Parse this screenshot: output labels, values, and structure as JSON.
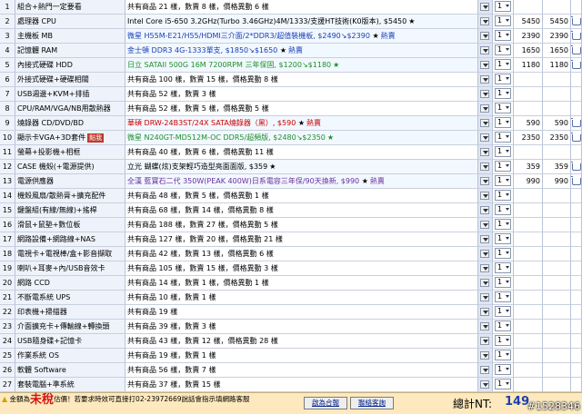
{
  "rows": [
    {
      "num": "1",
      "cat": "組合+熱門一定要看",
      "item": "共有商品 21 樣，數賣 8 樣，價格異動 6 樣",
      "type": "summary",
      "qty": "1"
    },
    {
      "num": "2",
      "cat": "處理器 CPU",
      "item": "Intel Core i5-650 3.2GHz(Turbo 3.46GHz)4M/1333/支援HT技術(K0版本), $5450",
      "type": "selected",
      "color": "black",
      "star": "★",
      "qty": "1",
      "price": "5450",
      "sub": "5450"
    },
    {
      "num": "3",
      "cat": "主機板 MB",
      "item": "微星 H55M-E21/H55/HDMI三介面/2*DDR3/超值裝機板, $2490↘$2390",
      "badge": "熱賣",
      "type": "selected",
      "color": "blue",
      "star": "★",
      "qty": "1",
      "price": "2390",
      "sub": "2390"
    },
    {
      "num": "4",
      "cat": "記憶體 RAM",
      "item": "金士頓 DDR3 4G-1333單支, $1850↘$1650",
      "badge": "熱賣",
      "type": "selected",
      "color": "blue",
      "star": "★",
      "qty": "1",
      "price": "1650",
      "sub": "1650"
    },
    {
      "num": "5",
      "cat": "內接式硬碟 HDD",
      "item": "日立 SATAII 500G 16M 7200RPM 三年保固, $1200↘$1180",
      "type": "selected",
      "color": "green",
      "star": "★",
      "starColor": "g",
      "qty": "1",
      "price": "1180",
      "sub": "1180"
    },
    {
      "num": "6",
      "cat": "外接式硬碟+硬碟相關",
      "item": "共有商品 100 樣，數賣 15 樣，價格異動 8 樣",
      "type": "summary",
      "qty": "1"
    },
    {
      "num": "7",
      "cat": "USB週邊+KVM+排插",
      "item": "共有商品 52 樣，數賣 3 樣",
      "type": "summary",
      "qty": "1"
    },
    {
      "num": "8",
      "cat": "CPU/RAM/VGA/NB用散熱器",
      "item": "共有商品 52 樣，數賣 5 樣，價格異動 5 樣",
      "type": "summary",
      "qty": "1"
    },
    {
      "num": "9",
      "cat": "燒錄器 CD/DVD/BD",
      "item": "華碩 DRW-24B3ST/24X SATA燒錄器（黑）, $590",
      "badge": "熱賣",
      "type": "selected",
      "color": "red",
      "star": "★",
      "qty": "1",
      "price": "590",
      "sub": "590"
    },
    {
      "num": "10",
      "cat": "顯示卡VGA+3D套件",
      "tag": "點我",
      "item": "微星 N240GT-MD512M-OC DDR5/超頻版, $2480↘$2350",
      "type": "selected",
      "color": "green",
      "star": "★",
      "starColor": "g",
      "qty": "1",
      "price": "2350",
      "sub": "2350"
    },
    {
      "num": "11",
      "cat": "螢幕+投影機+相框",
      "item": "共有商品 40 樣，數賣 6 樣，價格異動 11 樣",
      "type": "summary",
      "qty": "1"
    },
    {
      "num": "12",
      "cat": "CASE 機殼(+電源提供)",
      "item": "立光 蝴蝶(炫)支架輕巧造型亮面面版, $359",
      "type": "selected",
      "color": "black",
      "star": "★",
      "qty": "1",
      "price": "359",
      "sub": "359"
    },
    {
      "num": "13",
      "cat": "電源供應器",
      "item": "全漢 藍寶石二代 350W(PEAK 400W)日系電容三年保/90天換新, $990",
      "badge": "熱賣",
      "type": "selected",
      "color": "purple",
      "star": "★",
      "qty": "1",
      "price": "990",
      "sub": "990"
    },
    {
      "num": "14",
      "cat": "機殼風扇/散熱膏+擴充配件",
      "item": "共有商品 48 樣，數賣 5 樣，價格異動 1 樣",
      "type": "summary",
      "qty": "1"
    },
    {
      "num": "15",
      "cat": "鍵盤組(有線/無線)+搖桿",
      "item": "共有商品 68 樣，數賣 14 樣，價格異動 8 樣",
      "type": "summary",
      "qty": "1"
    },
    {
      "num": "16",
      "cat": "滑鼠+鼠墊+數位板",
      "item": "共有商品 188 樣，數賣 27 樣，價格異動 5 樣",
      "type": "summary",
      "qty": "1"
    },
    {
      "num": "17",
      "cat": "網路設備+網路線+NAS",
      "item": "共有商品 127 樣，數賣 20 樣，價格異動 21 樣",
      "type": "summary",
      "qty": "1"
    },
    {
      "num": "18",
      "cat": "電視卡+電視棒/盒+影音擷取",
      "item": "共有商品 42 樣，數賣 13 樣，價格異動 6 樣",
      "type": "summary",
      "qty": "1"
    },
    {
      "num": "19",
      "cat": "喇叭+耳麥+內/USB音效卡",
      "item": "共有商品 105 樣，數賣 15 樣，價格異動 3 樣",
      "type": "summary",
      "qty": "1"
    },
    {
      "num": "20",
      "cat": "網路 CCD",
      "item": "共有商品 14 樣，數賣 1 樣，價格異動 1 樣",
      "type": "summary",
      "qty": "1"
    },
    {
      "num": "21",
      "cat": "不斷電系統 UPS",
      "item": "共有商品 10 樣，數賣 1 樣",
      "type": "summary",
      "qty": "1"
    },
    {
      "num": "22",
      "cat": "印表機+掃描器",
      "item": "共有商品 19 樣",
      "type": "summary",
      "qty": "1"
    },
    {
      "num": "23",
      "cat": "介面擴充卡+傳輸線+轉換頭",
      "item": "共有商品 39 樣，數賣 3 樣",
      "type": "summary",
      "qty": "1"
    },
    {
      "num": "24",
      "cat": "USB隨身碟+記憶卡",
      "item": "共有商品 43 樣，數賣 12 樣，價格異動 28 樣",
      "type": "summary",
      "qty": "1"
    },
    {
      "num": "25",
      "cat": "作業系統 OS",
      "item": "共有商品 19 樣，數賣 1 樣",
      "type": "summary",
      "qty": "1"
    },
    {
      "num": "26",
      "cat": "軟體 Software",
      "item": "共有商品 56 樣，數賣 7 樣",
      "type": "summary",
      "qty": "1"
    },
    {
      "num": "27",
      "cat": "套裝電腦+準系統",
      "item": "共有商品 37 樣，數賣 15 樣",
      "type": "summary",
      "qty": "1"
    }
  ],
  "footer": {
    "line1_pre": "金額為",
    "line1_big": "未稅",
    "line1_post": "估價！若要求時效可直接打02-23972669說話會指示填網路客服",
    "line2": "",
    "btn_save": "啟為合報",
    "btn_contact": "聯絡客詢",
    "total_label": "總計NT:",
    "total_value": "149",
    "watermark": "#1528346"
  },
  "colors": {
    "cat_bg": "#eef3fb",
    "selected_bg": "#f2f8ff",
    "footer_bg": "#fde9bd",
    "blue": "#1a3fb3",
    "green": "#1b8f2a",
    "red": "#cc0000",
    "purple": "#6a2fa0"
  }
}
